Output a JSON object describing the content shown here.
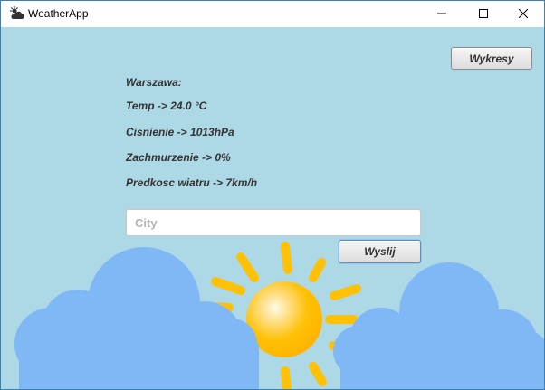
{
  "window": {
    "title": "WeatherApp",
    "icon": "cloud-sun-icon",
    "controls": [
      "minimize-icon",
      "maximize-icon",
      "close-icon"
    ]
  },
  "toolbar": {
    "charts_label": "Wykresy"
  },
  "weather": {
    "city": "Warszawa:",
    "temperature": "Temp -> 24.0 °C",
    "pressure": "Cisnienie -> 1013hPa",
    "cloudiness": "Zachmurzenie -> 0%",
    "wind": "Predkosc wiatru -> 7km/h"
  },
  "search": {
    "value": "",
    "placeholder": "City",
    "send_label": "Wyslij"
  },
  "colors": {
    "background": "#add8e6",
    "cloud": "#7fb8f5",
    "sun": "#ffc107",
    "sun_ray": "#ffc107"
  }
}
